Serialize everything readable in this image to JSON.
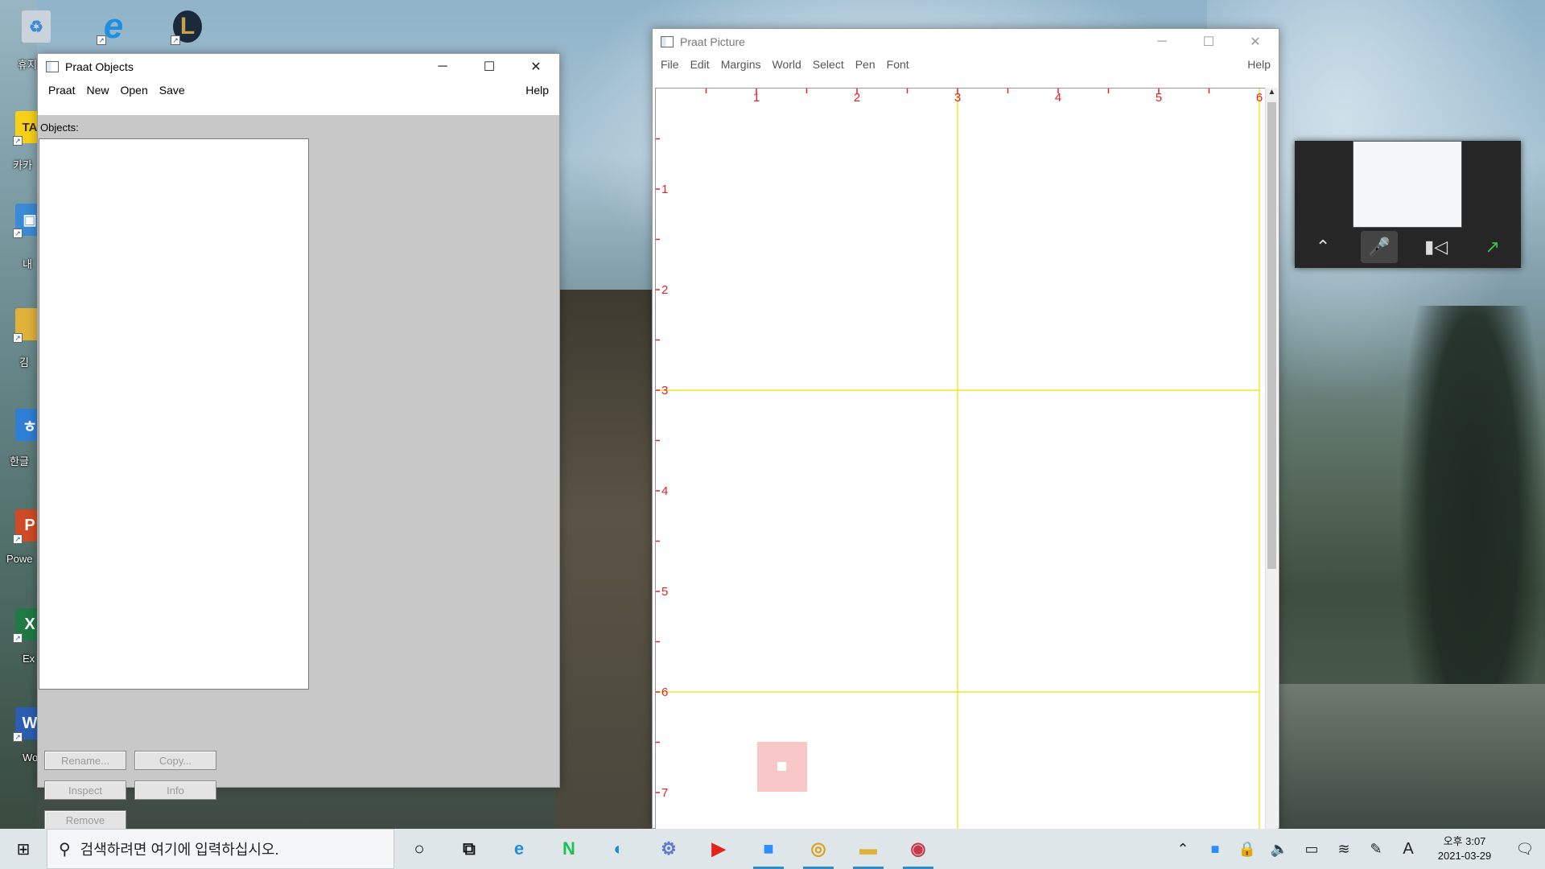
{
  "desktop": {
    "icons": [
      {
        "name": "recycle-bin",
        "label": "휴지",
        "glyph": "♻",
        "color": "#9aa9b4"
      },
      {
        "name": "internet-explorer",
        "label": "",
        "glyph": "e",
        "color": "#1f8fe0"
      },
      {
        "name": "league-of-legends",
        "label": "",
        "glyph": "L",
        "color": "#9a7b3a"
      },
      {
        "name": "kakaotalk",
        "label": "카카",
        "glyph": "TA",
        "color": "#f7d118"
      },
      {
        "name": "my-pc",
        "label": "내",
        "glyph": "▣",
        "color": "#3a8ad6"
      },
      {
        "name": "folder",
        "label": "김",
        "glyph": "▆",
        "color": "#e0b23a"
      },
      {
        "name": "hangul",
        "label": "한글",
        "glyph": "ㅎ",
        "color": "#2f7fd6"
      },
      {
        "name": "powerpoint",
        "label": "Powe",
        "glyph": "P",
        "color": "#d04a26"
      },
      {
        "name": "excel",
        "label": "Ex",
        "glyph": "X",
        "color": "#1f7a44"
      },
      {
        "name": "word",
        "label": "Wo",
        "glyph": "W",
        "color": "#2b5eb3"
      }
    ]
  },
  "objects_window": {
    "title": "Praat Objects",
    "menu": [
      "Praat",
      "New",
      "Open",
      "Save"
    ],
    "help": "Help",
    "objects_label": "Objects:",
    "buttons": {
      "rename": "Rename...",
      "copy": "Copy...",
      "inspect": "Inspect",
      "info": "Info",
      "remove": "Remove"
    }
  },
  "picture_window": {
    "title": "Praat Picture",
    "menu": [
      "File",
      "Edit",
      "Margins",
      "World",
      "Select",
      "Pen",
      "Font"
    ],
    "help": "Help",
    "top_ruler": [
      "1",
      "2",
      "3",
      "4",
      "5",
      "6"
    ],
    "left_ruler": [
      "1",
      "2",
      "3",
      "4",
      "5",
      "6",
      "7"
    ],
    "colors": {
      "ruler": "#e0202a",
      "grid": "#f0e000",
      "selection": "#f8c8c8"
    }
  },
  "zoom_mini": {
    "buttons": [
      "chevron-up-icon",
      "mic-muted-icon",
      "video-off-icon",
      "share-icon"
    ]
  },
  "taskbar": {
    "search_placeholder": "검색하려면 여기에 입력하십시오.",
    "apps": [
      {
        "name": "cortana",
        "glyph": "○",
        "active": false
      },
      {
        "name": "task-view",
        "glyph": "⧉",
        "active": false
      },
      {
        "name": "internet-explorer",
        "glyph": "e",
        "active": false
      },
      {
        "name": "naver",
        "glyph": "N",
        "active": false
      },
      {
        "name": "edge",
        "glyph": "◐",
        "active": false
      },
      {
        "name": "app-generic",
        "glyph": "⚙",
        "active": false
      },
      {
        "name": "youtube",
        "glyph": "▶",
        "active": false
      },
      {
        "name": "zoom",
        "glyph": "■",
        "active": true
      },
      {
        "name": "chrome",
        "glyph": "◎",
        "active": true
      },
      {
        "name": "file-explorer",
        "glyph": "▬",
        "active": true
      },
      {
        "name": "praat",
        "glyph": "◉",
        "active": true
      }
    ],
    "time": "오후 3:07",
    "date": "2021-03-29"
  }
}
